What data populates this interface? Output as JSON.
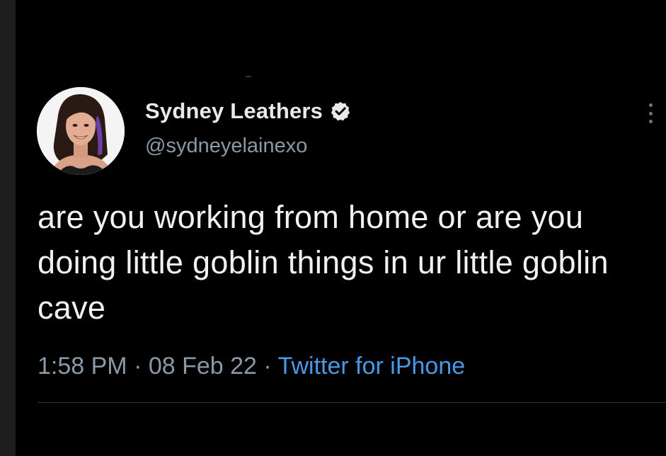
{
  "tweet": {
    "author": {
      "display_name": "Sydney Leathers",
      "handle": "@sydneyelainexo",
      "verified": true,
      "avatar_icon": "profile-photo"
    },
    "text": "are you working from home or are you doing little goblin things in ur little goblin cave",
    "meta": {
      "time": "1:58 PM",
      "separator_1": " · ",
      "date": "08 Feb 22",
      "separator_2": " · ",
      "source": "Twitter for iPhone"
    },
    "more_icon": "more-options-icon"
  },
  "colors": {
    "background": "#000000",
    "text": "#e7e9ea",
    "secondary_text": "#8b98a5",
    "link": "#4a99e9",
    "verified_badge": "#e7e9ea"
  }
}
